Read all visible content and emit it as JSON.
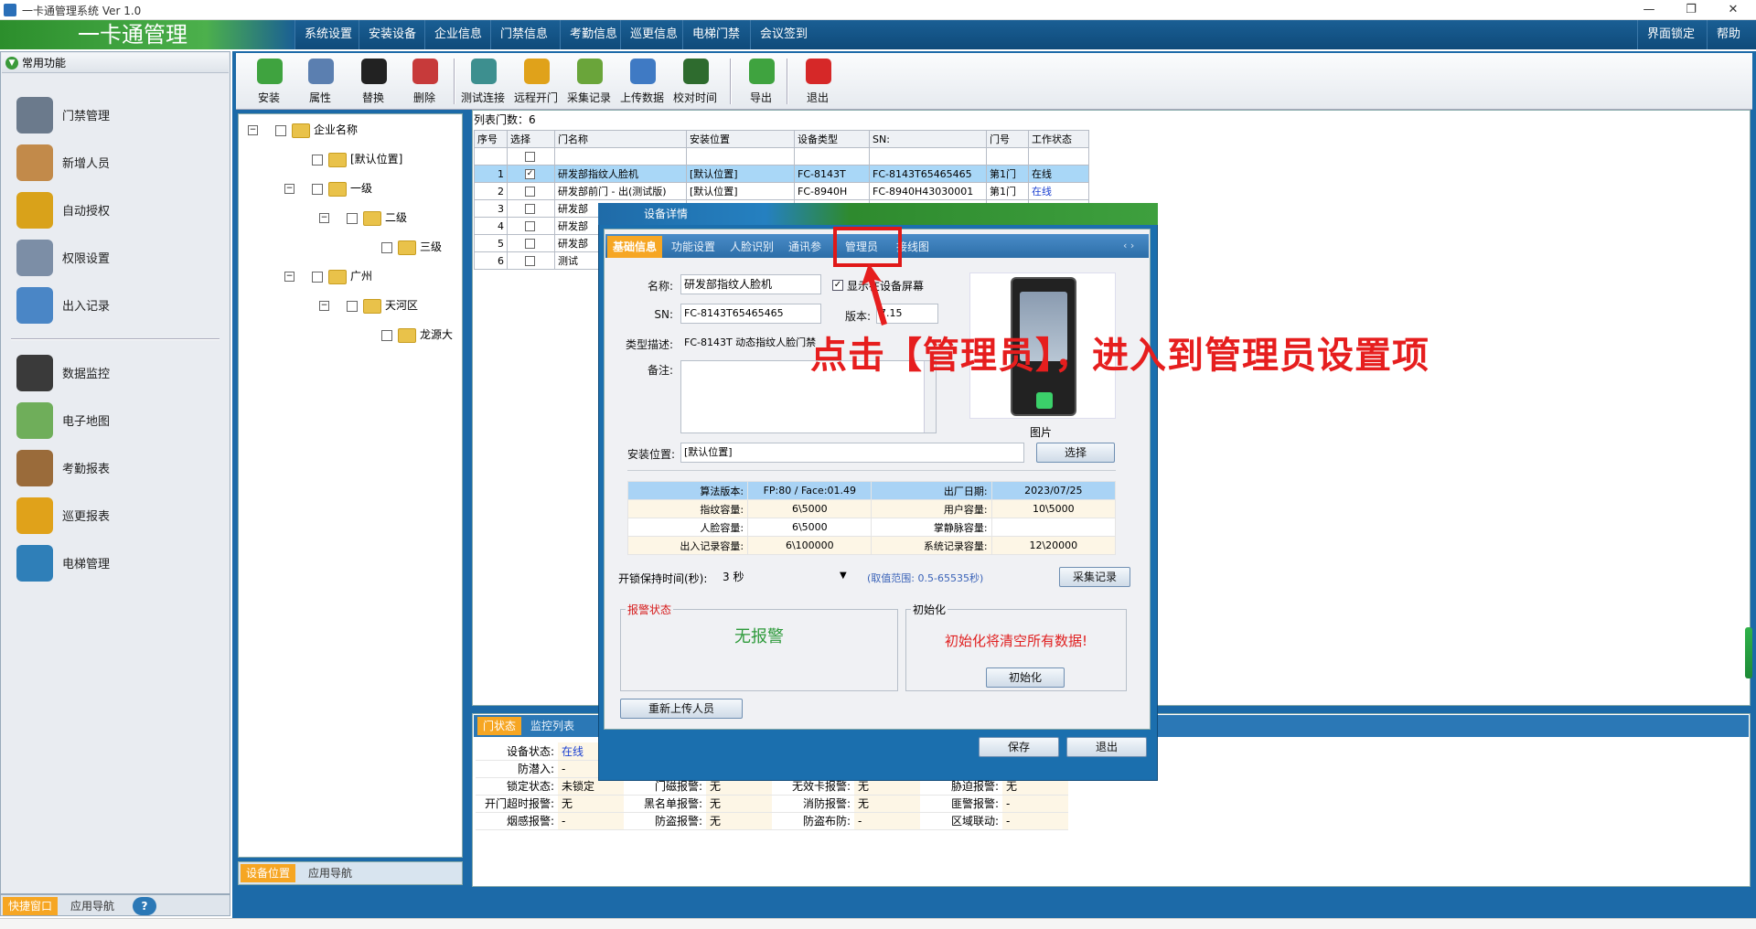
{
  "window": {
    "title": "一卡通管理系统 Ver 1.0",
    "logo": "一卡通管理"
  },
  "menu": [
    "系统设置",
    "安装设备",
    "企业信息",
    "门禁信息",
    "考勤信息",
    "巡更信息",
    "电梯门禁",
    "会议签到"
  ],
  "menu_right": [
    "界面锁定",
    "帮助"
  ],
  "sidebar": {
    "header": "常用功能",
    "items": [
      {
        "label": "门禁管理",
        "icon": "door-access-icon"
      },
      {
        "label": "新增人员",
        "icon": "person-icon"
      },
      {
        "label": "自动授权",
        "icon": "card-icon"
      },
      {
        "label": "权限设置",
        "icon": "permission-icon"
      },
      {
        "label": "出入记录",
        "icon": "magnifier-icon"
      },
      {
        "label": "数据监控",
        "icon": "camera-icon"
      },
      {
        "label": "电子地图",
        "icon": "map-icon"
      },
      {
        "label": "考勤报表",
        "icon": "clock-icon"
      },
      {
        "label": "巡更报表",
        "icon": "patrol-icon"
      },
      {
        "label": "电梯管理",
        "icon": "elevator-icon"
      }
    ],
    "tabs": [
      "快捷窗口",
      "应用导航"
    ]
  },
  "toolbar": [
    {
      "label": "安装",
      "color": "#3fa33f"
    },
    {
      "label": "属性",
      "color": "#5b7fb0"
    },
    {
      "label": "替换",
      "color": "#222222"
    },
    {
      "label": "删除",
      "color": "#c73a3a"
    },
    {
      "label": "测试连接",
      "color": "#3d8f8f"
    },
    {
      "label": "远程开门",
      "color": "#e0a21a"
    },
    {
      "label": "采集记录",
      "color": "#6aa53a"
    },
    {
      "label": "上传数据",
      "color": "#3f7ac4"
    },
    {
      "label": "校对时间",
      "color": "#2e6b2e"
    },
    {
      "label": "导出",
      "color": "#3fa33f"
    },
    {
      "label": "退出",
      "color": "#d62828"
    }
  ],
  "tree": {
    "root": "企业名称",
    "nodes": [
      "[默认位置]",
      "一级",
      "二级",
      "三级",
      "广州",
      "天河区",
      "龙源大"
    ],
    "tabs": [
      "设备位置",
      "应用导航"
    ]
  },
  "grid": {
    "count_label": "列表门数：6",
    "headers": [
      "序号",
      "选择",
      "门名称",
      "安装位置",
      "设备类型",
      "SN:",
      "门号",
      "工作状态"
    ],
    "rows": [
      [
        "1",
        "",
        "研发部指纹人脸机",
        "[默认位置]",
        "FC-8143T",
        "FC-8143T65465465",
        "第1门",
        "在线"
      ],
      [
        "2",
        "",
        "研发部前门 - 出(测试版)",
        "[默认位置]",
        "FC-8940H",
        "FC-8940H43030001",
        "第1门",
        "在线"
      ],
      [
        "3",
        "",
        "研发部",
        "",
        "",
        "",
        "",
        ""
      ],
      [
        "4",
        "",
        "研发部",
        "",
        "",
        "",
        "",
        ""
      ],
      [
        "5",
        "",
        "研发部",
        "",
        "",
        "",
        "",
        ""
      ],
      [
        "6",
        "",
        "测试",
        "",
        "",
        "",
        "",
        ""
      ]
    ]
  },
  "bottom": {
    "tabs": [
      "门状态",
      "监控列表"
    ],
    "rows": [
      [
        [
          "设备状态:",
          "在线"
        ]
      ],
      [
        [
          "防潜入:",
          "-"
        ]
      ],
      [
        [
          "锁定状态:",
          "未锁定"
        ],
        [
          "门磁报警:",
          "无"
        ],
        [
          "无效卡报警:",
          "无"
        ],
        [
          "胁迫报警:",
          "无"
        ]
      ],
      [
        [
          "开门超时报警:",
          "无"
        ],
        [
          "黑名单报警:",
          "无"
        ],
        [
          "消防报警:",
          "无"
        ],
        [
          "匪警报警:",
          "-"
        ]
      ],
      [
        [
          "烟感报警:",
          "-"
        ],
        [
          "防盗报警:",
          "无"
        ],
        [
          "防盗布防:",
          "-"
        ],
        [
          "区域联动:",
          "-"
        ]
      ]
    ]
  },
  "dialog": {
    "title": "设备详情",
    "tabs": [
      "基础信息",
      "功能设置",
      "人脸识别",
      "通讯参数",
      "管理员",
      "接线图"
    ],
    "name_label": "名称:",
    "name_value": "研发部指纹人脸机",
    "show_screen": "显示在设备屏幕",
    "sn_label": "SN:",
    "sn_value": "FC-8143T65465465",
    "version_label": "版本:",
    "version_value": "7.15",
    "type_label": "类型描述:",
    "type_value": "FC-8143T 动态指纹人脸门禁",
    "remark_label": "备注:",
    "image_label": "图片",
    "location_label": "安装位置:",
    "location_value": "[默认位置]",
    "select_btn": "选择",
    "info": [
      [
        "算法版本:",
        "FP:80 / Face:01.49",
        "出厂日期:",
        "2023/07/25"
      ],
      [
        "指纹容量:",
        "6\\5000",
        "用户容量:",
        "10\\5000"
      ],
      [
        "人脸容量:",
        "6\\5000",
        "掌静脉容量:",
        ""
      ],
      [
        "出入记录容量:",
        "6\\100000",
        "系统记录容量:",
        "12\\20000"
      ]
    ],
    "lock_label": "开锁保持时间(秒):",
    "lock_value": "3 秒",
    "lock_range": "(取值范围: 0.5-65535秒)",
    "collect_btn": "采集记录",
    "alarm_title": "报警状态",
    "alarm_text": "无报警",
    "init_title": "初始化",
    "init_warn": "初始化将清空所有数据!",
    "init_btn": "初始化",
    "reupload_btn": "重新上传人员",
    "save_btn": "保存",
    "exit_btn": "退出"
  },
  "annotation": "点击【管理员】，进入到管理员设置项",
  "colors": {
    "accent": "#1c6aa8",
    "annotation": "#e61e1e",
    "online": "#1a3fd1",
    "selected_row": "#a9d7f7"
  }
}
